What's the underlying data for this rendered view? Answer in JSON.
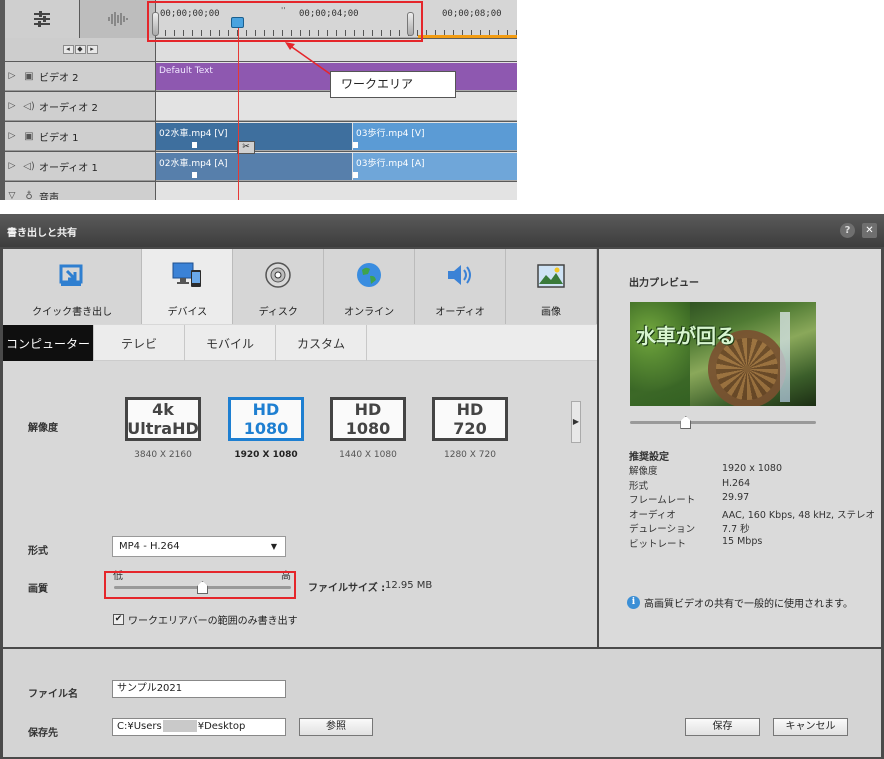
{
  "timeline": {
    "timecodes": [
      "00;00;00;00",
      "00;00;04;00",
      "00;00;08;00"
    ],
    "nav_glyphs": [
      "◂",
      "◆",
      "▸"
    ],
    "tracks": [
      {
        "label": "ビデオ 2",
        "type": "video"
      },
      {
        "label": "オーディオ 2",
        "type": "audio"
      },
      {
        "label": "ビデオ 1",
        "type": "video"
      },
      {
        "label": "オーディオ 1",
        "type": "audio"
      },
      {
        "label": "音声",
        "type": "voice"
      }
    ],
    "clips": {
      "text_clip": "Default Text",
      "video1_a": "02水車.mp4 [V]",
      "video1_b": "03歩行.mp4 [V]",
      "audio1_a": "02水車.mp4 [A]",
      "audio1_b": "03歩行.mp4 [A]"
    },
    "callout_label": "ワークエリア"
  },
  "dialog": {
    "title": "書き出しと共有",
    "help_glyph": "?",
    "close_glyph": "✕",
    "categories": [
      {
        "label": "クイック書き出し",
        "icon": "quick-export-icon",
        "glyph": "⇲",
        "color": "#2f7fd0"
      },
      {
        "label": "デバイス",
        "icon": "device-icon",
        "glyph": "🖥",
        "color": "#1e5aa8"
      },
      {
        "label": "ディスク",
        "icon": "disc-icon",
        "glyph": "💿",
        "color": "#555555"
      },
      {
        "label": "オンライン",
        "icon": "globe-icon",
        "glyph": "🌐",
        "color": "#2e8b3e"
      },
      {
        "label": "オーディオ",
        "icon": "speaker-icon",
        "glyph": "🔊",
        "color": "#2f7fd0"
      },
      {
        "label": "画像",
        "icon": "image-icon",
        "glyph": "🖼",
        "color": "#3a7a3a"
      }
    ],
    "active_category": 1,
    "subtabs": [
      "コンピューター",
      "テレビ",
      "モバイル",
      "カスタム"
    ],
    "active_subtab": 0,
    "resolution_label": "解像度",
    "resolutions": [
      {
        "line1": "4k",
        "line2": "UltraHD",
        "sub": "3840 X 2160"
      },
      {
        "line1": "HD",
        "line2": "1080",
        "sub": "1920 X 1080"
      },
      {
        "line1": "HD",
        "line2": "1080",
        "sub": "1440 X 1080"
      },
      {
        "line1": "HD",
        "line2": "720",
        "sub": "1280 X 720"
      }
    ],
    "selected_resolution": 1,
    "format_label": "形式",
    "format_value": "MP4 - H.264",
    "quality_label": "画質",
    "quality_low": "低",
    "quality_high": "高",
    "quality_level": 0.5,
    "filesize_label": "ファイルサイズ :",
    "filesize_value": "12.95 MB",
    "workarea_checkbox_label": "ワークエリアバーの範囲のみ書き出す",
    "workarea_checked": true,
    "preview": {
      "title": "出力プレビュー",
      "overlay_text": "水車が回る",
      "scrub_position": 0.3
    },
    "recommended": {
      "title": "推奨設定",
      "rows": [
        {
          "k": "解像度",
          "v": "1920 x 1080"
        },
        {
          "k": "形式",
          "v": "H.264"
        },
        {
          "k": "フレームレート",
          "v": "29.97"
        },
        {
          "k": "オーディオ",
          "v": "AAC, 160 Kbps, 48 kHz, ステレオ"
        },
        {
          "k": "デュレーション",
          "v": "7.7 秒"
        },
        {
          "k": "ビットレート",
          "v": "15 Mbps"
        }
      ],
      "note": "高画質ビデオの共有で一般的に使用されます。"
    },
    "filename_label": "ファイル名",
    "filename_value": "サンプル2021",
    "dest_label": "保存先",
    "dest_value_pre": "C:¥Users",
    "dest_value_post": "¥Desktop",
    "browse_label": "参照",
    "save_label": "保存",
    "cancel_label": "キャンセル"
  }
}
